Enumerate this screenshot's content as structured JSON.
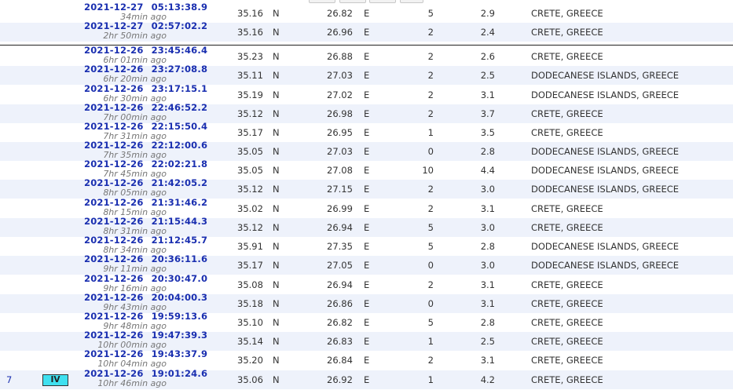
{
  "rows": [
    {
      "date": "2021-12-27",
      "time": "05:13:38.9",
      "ago": "34min ago",
      "lat": "35.16",
      "ns": "N",
      "lon": "26.82",
      "ew": "E",
      "depth": "5",
      "mag": "2.9",
      "region": "CRETE, GREECE"
    },
    {
      "date": "2021-12-27",
      "time": "02:57:02.2",
      "ago": "2hr 50min ago",
      "lat": "35.16",
      "ns": "N",
      "lon": "26.96",
      "ew": "E",
      "depth": "2",
      "mag": "2.4",
      "region": "CRETE, GREECE"
    },
    {
      "date": "2021-12-26",
      "time": "23:45:46.4",
      "ago": "6hr 01min ago",
      "lat": "35.23",
      "ns": "N",
      "lon": "26.88",
      "ew": "E",
      "depth": "2",
      "mag": "2.6",
      "region": "CRETE, GREECE"
    },
    {
      "date": "2021-12-26",
      "time": "23:27:08.8",
      "ago": "6hr 20min ago",
      "lat": "35.11",
      "ns": "N",
      "lon": "27.03",
      "ew": "E",
      "depth": "2",
      "mag": "2.5",
      "region": "DODECANESE ISLANDS, GREECE"
    },
    {
      "date": "2021-12-26",
      "time": "23:17:15.1",
      "ago": "6hr 30min ago",
      "lat": "35.19",
      "ns": "N",
      "lon": "27.02",
      "ew": "E",
      "depth": "2",
      "mag": "3.1",
      "region": "DODECANESE ISLANDS, GREECE"
    },
    {
      "date": "2021-12-26",
      "time": "22:46:52.2",
      "ago": "7hr 00min ago",
      "lat": "35.12",
      "ns": "N",
      "lon": "26.98",
      "ew": "E",
      "depth": "2",
      "mag": "3.7",
      "region": "CRETE, GREECE"
    },
    {
      "date": "2021-12-26",
      "time": "22:15:50.4",
      "ago": "7hr 31min ago",
      "lat": "35.17",
      "ns": "N",
      "lon": "26.95",
      "ew": "E",
      "depth": "1",
      "mag": "3.5",
      "region": "CRETE, GREECE"
    },
    {
      "date": "2021-12-26",
      "time": "22:12:00.6",
      "ago": "7hr 35min ago",
      "lat": "35.05",
      "ns": "N",
      "lon": "27.03",
      "ew": "E",
      "depth": "0",
      "mag": "2.8",
      "region": "DODECANESE ISLANDS, GREECE"
    },
    {
      "date": "2021-12-26",
      "time": "22:02:21.8",
      "ago": "7hr 45min ago",
      "lat": "35.05",
      "ns": "N",
      "lon": "27.08",
      "ew": "E",
      "depth": "10",
      "mag": "4.4",
      "region": "DODECANESE ISLANDS, GREECE"
    },
    {
      "date": "2021-12-26",
      "time": "21:42:05.2",
      "ago": "8hr 05min ago",
      "lat": "35.12",
      "ns": "N",
      "lon": "27.15",
      "ew": "E",
      "depth": "2",
      "mag": "3.0",
      "region": "DODECANESE ISLANDS, GREECE"
    },
    {
      "date": "2021-12-26",
      "time": "21:31:46.2",
      "ago": "8hr 15min ago",
      "lat": "35.02",
      "ns": "N",
      "lon": "26.99",
      "ew": "E",
      "depth": "2",
      "mag": "3.1",
      "region": "CRETE, GREECE"
    },
    {
      "date": "2021-12-26",
      "time": "21:15:44.3",
      "ago": "8hr 31min ago",
      "lat": "35.12",
      "ns": "N",
      "lon": "26.94",
      "ew": "E",
      "depth": "5",
      "mag": "3.0",
      "region": "CRETE, GREECE"
    },
    {
      "date": "2021-12-26",
      "time": "21:12:45.7",
      "ago": "8hr 34min ago",
      "lat": "35.91",
      "ns": "N",
      "lon": "27.35",
      "ew": "E",
      "depth": "5",
      "mag": "2.8",
      "region": "DODECANESE ISLANDS, GREECE"
    },
    {
      "date": "2021-12-26",
      "time": "20:36:11.6",
      "ago": "9hr 11min ago",
      "lat": "35.17",
      "ns": "N",
      "lon": "27.05",
      "ew": "E",
      "depth": "0",
      "mag": "3.0",
      "region": "DODECANESE ISLANDS, GREECE"
    },
    {
      "date": "2021-12-26",
      "time": "20:30:47.0",
      "ago": "9hr 16min ago",
      "lat": "35.08",
      "ns": "N",
      "lon": "26.94",
      "ew": "E",
      "depth": "2",
      "mag": "3.1",
      "region": "CRETE, GREECE"
    },
    {
      "date": "2021-12-26",
      "time": "20:04:00.3",
      "ago": "9hr 43min ago",
      "lat": "35.18",
      "ns": "N",
      "lon": "26.86",
      "ew": "E",
      "depth": "0",
      "mag": "3.1",
      "region": "CRETE, GREECE"
    },
    {
      "date": "2021-12-26",
      "time": "19:59:13.6",
      "ago": "9hr 48min ago",
      "lat": "35.10",
      "ns": "N",
      "lon": "26.82",
      "ew": "E",
      "depth": "5",
      "mag": "2.8",
      "region": "CRETE, GREECE"
    },
    {
      "date": "2021-12-26",
      "time": "19:47:39.3",
      "ago": "10hr 00min ago",
      "lat": "35.14",
      "ns": "N",
      "lon": "26.83",
      "ew": "E",
      "depth": "1",
      "mag": "2.5",
      "region": "CRETE, GREECE"
    },
    {
      "date": "2021-12-26",
      "time": "19:43:37.9",
      "ago": "10hr 04min ago",
      "lat": "35.20",
      "ns": "N",
      "lon": "26.84",
      "ew": "E",
      "depth": "2",
      "mag": "3.1",
      "region": "CRETE, GREECE"
    },
    {
      "date": "2021-12-26",
      "time": "19:01:24.6",
      "ago": "10hr 46min ago",
      "lat": "35.06",
      "ns": "N",
      "lon": "26.92",
      "ew": "E",
      "depth": "1",
      "mag": "4.2",
      "region": "CRETE, GREECE",
      "felt_count": "7",
      "intensity": "IV",
      "intensity_color": "#3fe0f0"
    }
  ],
  "colors": {
    "datetime": "#1a2fb0",
    "alt_row": "#eef2fb",
    "ago": "#777777"
  }
}
